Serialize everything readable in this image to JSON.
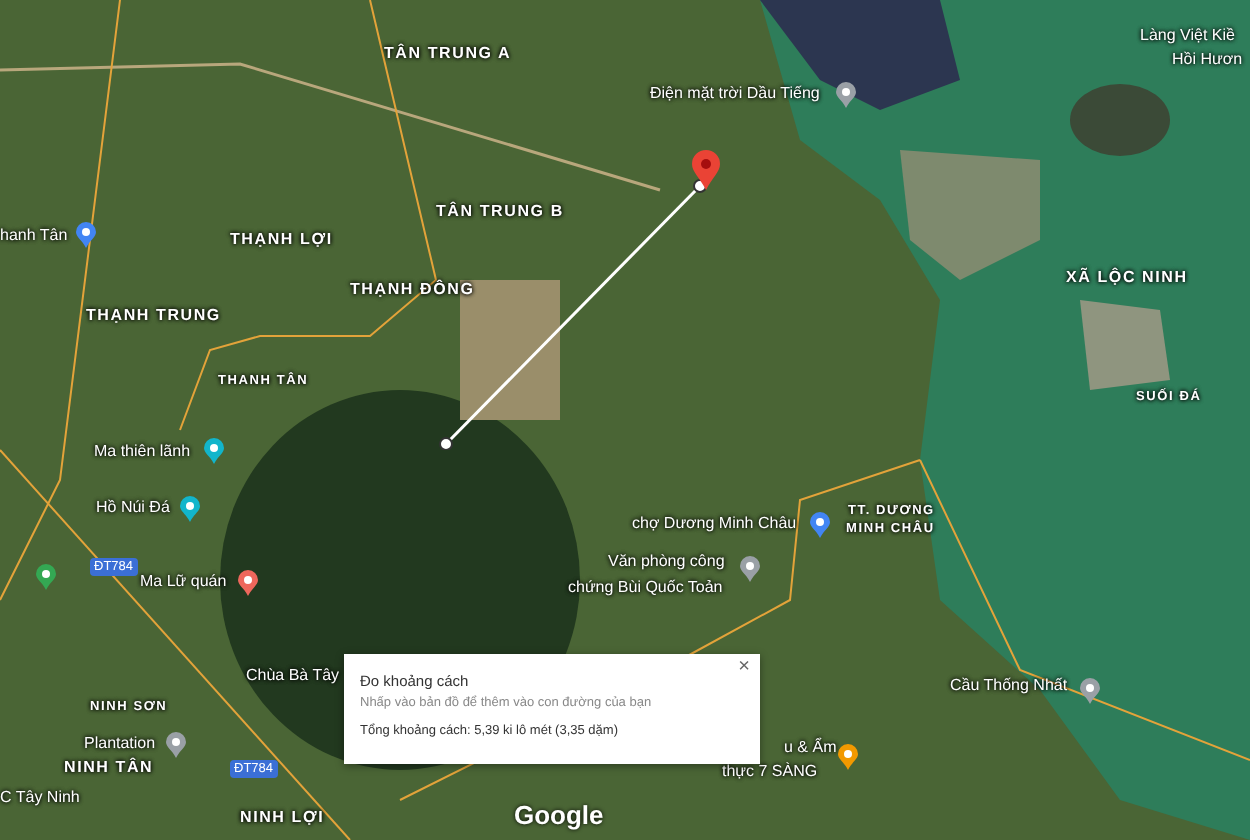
{
  "map": {
    "labels": [
      {
        "text": "TÂN TRUNG A",
        "kind": "area"
      },
      {
        "text": "TÂN TRUNG B",
        "kind": "area"
      },
      {
        "text": "THẠNH LỢI",
        "kind": "area"
      },
      {
        "text": "THẠNH ĐÔNG",
        "kind": "area"
      },
      {
        "text": "THẠNH TRUNG",
        "kind": "area"
      },
      {
        "text": "THANH TÂN",
        "kind": "small"
      },
      {
        "text": "hanh Tân",
        "kind": "poi"
      },
      {
        "text": "Điện mặt trời Dầu Tiếng",
        "kind": "poi"
      },
      {
        "text": "Làng Việt Kiề",
        "kind": "poi"
      },
      {
        "text": "Hồi Hươn",
        "kind": "poi"
      },
      {
        "text": "XÃ LỘC NINH",
        "kind": "area"
      },
      {
        "text": "SUỐI ĐÁ",
        "kind": "small"
      },
      {
        "text": "Ma thiên lãnh",
        "kind": "poi"
      },
      {
        "text": "Hồ Núi Đá",
        "kind": "poi"
      },
      {
        "text": "Ma Lữ quán",
        "kind": "poi"
      },
      {
        "text": "Chùa Bà Tây",
        "kind": "poi"
      },
      {
        "text": "NINH SƠN",
        "kind": "small"
      },
      {
        "text": "Plantation",
        "kind": "poi"
      },
      {
        "text": "NINH TÂN",
        "kind": "area"
      },
      {
        "text": "C Tây Ninh",
        "kind": "poi"
      },
      {
        "text": "NINH LỢI",
        "kind": "area"
      },
      {
        "text": "chợ Dương Minh Châu",
        "kind": "poi"
      },
      {
        "text": "TT. DƯƠNG",
        "kind": "small"
      },
      {
        "text": "MINH CHÂU",
        "kind": "small"
      },
      {
        "text": "Văn phòng công",
        "kind": "poi"
      },
      {
        "text": "chứng Bùi Quốc Toản",
        "kind": "poi"
      },
      {
        "text": "Cầu Thống Nhất",
        "kind": "poi"
      },
      {
        "text": "u & Ẩm",
        "kind": "poi"
      },
      {
        "text": "thực 7 SÀNG",
        "kind": "poi"
      }
    ],
    "pins": [
      {
        "color": "#4285f4"
      },
      {
        "color": "#9aa0a6"
      },
      {
        "color": "#12b5cb"
      },
      {
        "color": "#12b5cb"
      },
      {
        "color": "#ee675c"
      },
      {
        "color": "#9aa0a6"
      },
      {
        "color": "#4285f4"
      },
      {
        "color": "#9aa0a6"
      },
      {
        "color": "#9aa0a6"
      },
      {
        "color": "#f29900"
      },
      {
        "color": "#34a853"
      }
    ],
    "road_shields": [
      "ĐT784",
      "ĐT784"
    ],
    "logo": "Google"
  },
  "measure_dialog": {
    "title": "Đo khoảng cách",
    "hint": "Nhấp vào bản đồ để thêm vào con đường của bạn",
    "total": "Tổng khoảng cách: 5,39 ki lô mét (3,35 dặm)",
    "close": "×"
  }
}
